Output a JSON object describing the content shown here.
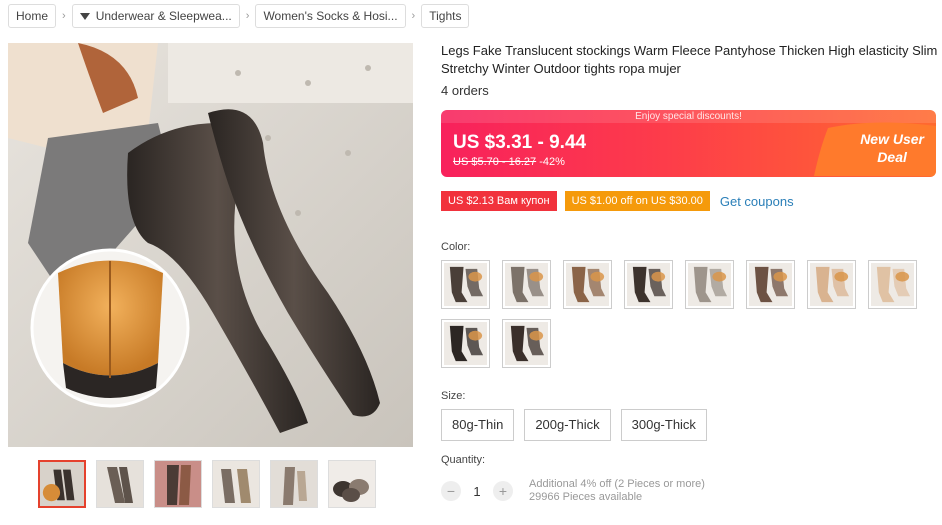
{
  "breadcrumb": {
    "home": "Home",
    "cat1": "Underwear & Sleepwea...",
    "cat2": "Women's Socks & Hosi...",
    "cat3": "Tights",
    "sep": "›"
  },
  "product": {
    "title": "Legs Fake Translucent stockings Warm Fleece Pantyhose Thicken High elasticity Slim Stretchy Winter Outdoor tights ropa mujer",
    "orders": "4 orders"
  },
  "price": {
    "banner": "Enjoy special discounts!",
    "current": "US $3.31 - 9.44",
    "original": "US $5.70 - 16.27",
    "discount": "-42%",
    "new_user_line1": "New User",
    "new_user_line2": "Deal"
  },
  "coupons": {
    "coupon1": "US $2.13 Вам купон",
    "coupon2": "US $1.00 off on US $30.00",
    "get": "Get coupons"
  },
  "color": {
    "label": "Color:",
    "options": [
      "black-brown",
      "grey",
      "coffee",
      "dark-brown",
      "light-grey",
      "brown",
      "nude",
      "skin",
      "black",
      "black-fleece"
    ]
  },
  "size": {
    "label": "Size:",
    "options": [
      "80g-Thin",
      "200g-Thick",
      "300g-Thick"
    ]
  },
  "quantity": {
    "label": "Quantity:",
    "value": "1",
    "minus": "−",
    "plus": "+",
    "note": "Additional 4% off (2 Pieces or more)",
    "available": "29966 Pieces available"
  },
  "colors": {
    "price_gradient_start": "#f8215c",
    "price_gradient_end": "#ff6a2f",
    "coupon_red": "#f1323c",
    "coupon_orange": "#f59a0b",
    "link": "#2a7fb8",
    "active_thumb": "#e5412d"
  }
}
